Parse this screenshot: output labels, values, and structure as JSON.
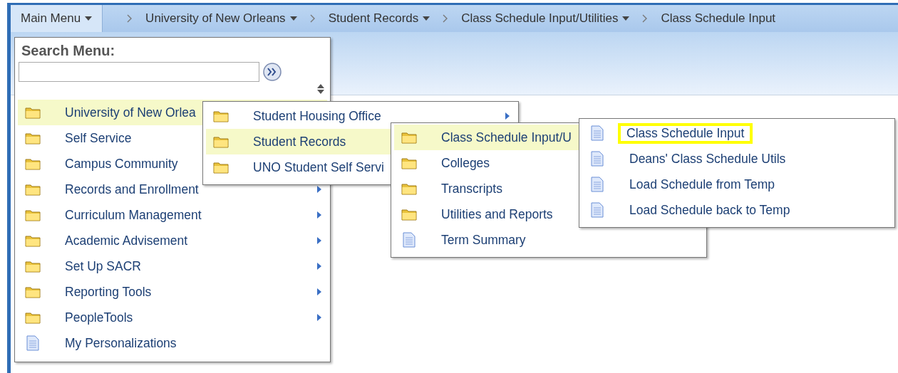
{
  "breadcrumb": [
    {
      "label": "Main Menu",
      "dropdown": true,
      "selected": true
    },
    {
      "label": "University of New Orleans",
      "dropdown": true,
      "selected": false
    },
    {
      "label": "Student Records",
      "dropdown": true,
      "selected": false
    },
    {
      "label": "Class Schedule Input/Utilities",
      "dropdown": true,
      "selected": false
    },
    {
      "label": "Class Schedule Input",
      "dropdown": false,
      "selected": false
    }
  ],
  "search": {
    "label": "Search Menu:"
  },
  "menus": [
    {
      "items": [
        {
          "kind": "folder",
          "label": "University of New Orlea",
          "selected": true,
          "submenu": false
        },
        {
          "kind": "folder",
          "label": "Self Service",
          "selected": false,
          "submenu": false
        },
        {
          "kind": "folder",
          "label": "Campus Community",
          "selected": false,
          "submenu": false
        },
        {
          "kind": "folder",
          "label": "Records and Enrollment",
          "selected": false,
          "submenu": true
        },
        {
          "kind": "folder",
          "label": "Curriculum Management",
          "selected": false,
          "submenu": true
        },
        {
          "kind": "folder",
          "label": "Academic Advisement",
          "selected": false,
          "submenu": true
        },
        {
          "kind": "folder",
          "label": "Set Up SACR",
          "selected": false,
          "submenu": true
        },
        {
          "kind": "folder",
          "label": "Reporting Tools",
          "selected": false,
          "submenu": true
        },
        {
          "kind": "folder",
          "label": "PeopleTools",
          "selected": false,
          "submenu": true
        },
        {
          "kind": "page",
          "label": "My Personalizations",
          "selected": false,
          "submenu": false
        }
      ]
    },
    {
      "items": [
        {
          "kind": "folder",
          "label": "Student Housing Office",
          "selected": false,
          "submenu": true
        },
        {
          "kind": "folder",
          "label": "Student Records",
          "selected": true,
          "submenu": false
        },
        {
          "kind": "folder",
          "label": "UNO Student Self Servi",
          "selected": false,
          "submenu": false
        }
      ]
    },
    {
      "items": [
        {
          "kind": "folder",
          "label": "Class Schedule Input/U",
          "selected": true,
          "submenu": false
        },
        {
          "kind": "folder",
          "label": "Colleges",
          "selected": false,
          "submenu": false
        },
        {
          "kind": "folder",
          "label": "Transcripts",
          "selected": false,
          "submenu": false
        },
        {
          "kind": "folder",
          "label": "Utilities and Reports",
          "selected": false,
          "submenu": false
        },
        {
          "kind": "page",
          "label": "Term Summary",
          "selected": false,
          "submenu": false
        }
      ]
    },
    {
      "items": [
        {
          "kind": "page",
          "label": "Class Schedule Input",
          "selected": false,
          "submenu": false,
          "highlighted": true
        },
        {
          "kind": "page",
          "label": "Deans' Class Schedule Utils",
          "selected": false,
          "submenu": false,
          "highlighted": false
        },
        {
          "kind": "page",
          "label": "Load Schedule from Temp",
          "selected": false,
          "submenu": false,
          "highlighted": false
        },
        {
          "kind": "page",
          "label": "Load Schedule back to Temp",
          "selected": false,
          "submenu": false,
          "highlighted": false
        }
      ]
    }
  ]
}
